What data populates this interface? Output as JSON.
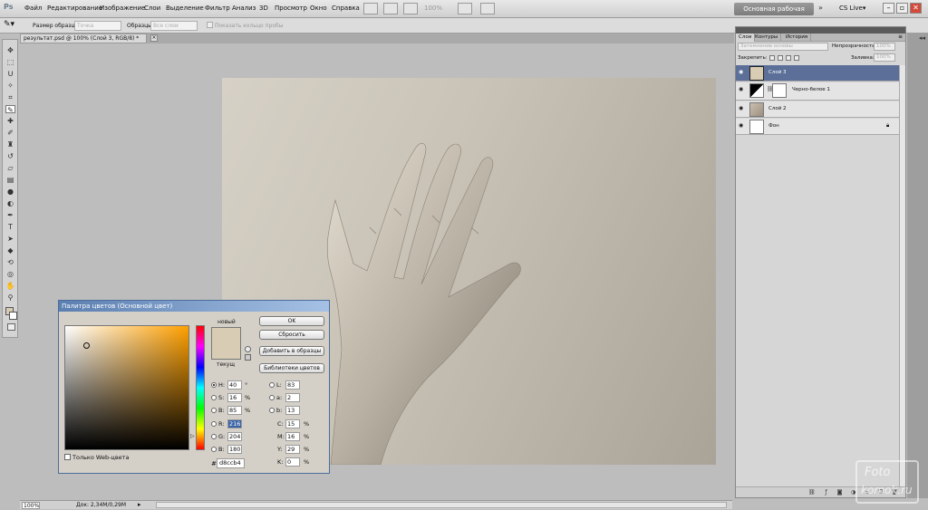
{
  "app": {
    "logo": "Ps"
  },
  "menu": [
    "Файл",
    "Редактирование",
    "Изображение",
    "Слои",
    "Выделение",
    "Фильтр",
    "Анализ",
    "3D",
    "Просмотр",
    "Окно",
    "Справка"
  ],
  "menubar": {
    "zoom": "100%",
    "workspace": "Основная рабочая среда",
    "cslive": "CS Live▾",
    "workspace_more": "»"
  },
  "options": {
    "sample_size_label": "Размер образца:",
    "sample_size_value": "Точка",
    "samples_label": "Образцы:",
    "samples_value": "Все слои",
    "show_ring_label": "Показать кольцо пробы"
  },
  "document": {
    "tab_title": "результат.psd @ 100% (Слой 3, RGB/8) *",
    "close": "×"
  },
  "status": {
    "zoom": "100%",
    "doc_size": "Док: 2,34М/0,29М",
    "arrow": "▸"
  },
  "color_picker": {
    "title": "Палитра цветов (Основной цвет)",
    "new_label": "новый",
    "current_label": "текущ",
    "new_color": "#d8ccb4",
    "current_color": "#d8ccb4",
    "buttons": {
      "ok": "OK",
      "reset": "Сбросить",
      "add_to_swatches": "Добавить в образцы",
      "color_libraries": "Библиотеки цветов"
    },
    "hsb": {
      "h_label": "H:",
      "h": "40",
      "h_unit": "°",
      "s_label": "S:",
      "s": "16",
      "s_unit": "%",
      "b_label": "B:",
      "b": "85",
      "b_unit": "%"
    },
    "rgb": {
      "r_label": "R:",
      "r": "216",
      "g_label": "G:",
      "g": "204",
      "b_label": "B:",
      "b": "180"
    },
    "lab": {
      "l_label": "L:",
      "l": "83",
      "a_label": "a:",
      "a": "2",
      "b_label": "b:",
      "b": "13"
    },
    "cmyk": {
      "c_label": "C:",
      "c": "15",
      "c_unit": "%",
      "m_label": "M:",
      "m": "16",
      "m_unit": "%",
      "y_label": "Y:",
      "y": "29",
      "y_unit": "%",
      "k_label": "K:",
      "k": "0",
      "k_unit": "%"
    },
    "hex_label": "#",
    "hex": "d8ccb4",
    "web_only_label": "Только Web-цвета"
  },
  "layers_panel": {
    "tabs": [
      "Слои",
      "Контуры",
      "История"
    ],
    "menu_icon": "≡",
    "blend_mode": "Затемнение основы",
    "opacity_label": "Непрозрачность:",
    "opacity_value": "100%",
    "lock_label": "Закрепить:",
    "fill_label": "Заливка:",
    "fill_value": "100%",
    "layers": [
      {
        "name": "Слой 3",
        "selected": true
      },
      {
        "name": "Черно-белое 1",
        "selected": false
      },
      {
        "name": "Слой 2",
        "selected": false
      },
      {
        "name": "Фон",
        "selected": false
      }
    ],
    "footer_icons": [
      "link-icon",
      "fx-icon",
      "mask-icon",
      "adjustment-icon",
      "folder-icon",
      "new-layer-icon",
      "trash-icon"
    ]
  },
  "window_controls": {
    "minimize": "–",
    "restore": "▫",
    "close": "✕"
  },
  "watermark": {
    "line1": "Foto",
    "line2": "komok.ru"
  }
}
